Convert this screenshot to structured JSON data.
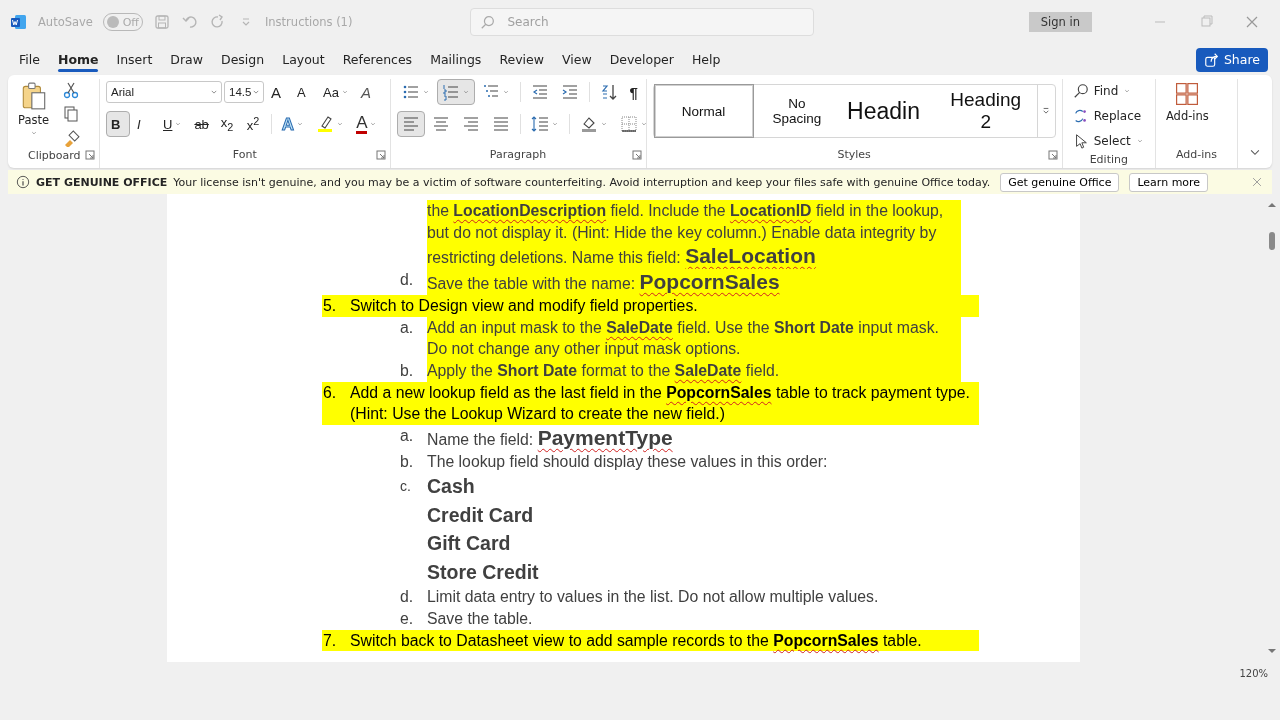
{
  "title_bar": {
    "autosave_label": "AutoSave",
    "autosave_on": false,
    "autosave_state": "Off",
    "document_title": "Instructions (1)",
    "search_placeholder": "Search",
    "sign_in": "Sign in"
  },
  "menu_tabs": [
    {
      "label": "File",
      "selected": false
    },
    {
      "label": "Home",
      "selected": true
    },
    {
      "label": "Insert",
      "selected": false
    },
    {
      "label": "Draw",
      "selected": false
    },
    {
      "label": "Design",
      "selected": false
    },
    {
      "label": "Layout",
      "selected": false
    },
    {
      "label": "References",
      "selected": false
    },
    {
      "label": "Mailings",
      "selected": false
    },
    {
      "label": "Review",
      "selected": false
    },
    {
      "label": "View",
      "selected": false
    },
    {
      "label": "Developer",
      "selected": false
    },
    {
      "label": "Help",
      "selected": false
    }
  ],
  "share": "Share",
  "clipboard": {
    "label": "Clipboard",
    "paste": "Paste"
  },
  "font": {
    "label": "Font",
    "font_name": "Arial",
    "font_size": "14.5",
    "row1": [
      {
        "kind": "grow",
        "text": "A"
      },
      {
        "kind": "shrink",
        "text": "A"
      },
      {
        "kind": "case",
        "text": "Aa"
      },
      {
        "kind": "clear",
        "text": "A"
      }
    ],
    "toggles": [
      {
        "text": "B",
        "selected": true
      },
      {
        "text": "I",
        "selected": false
      },
      {
        "text": "U",
        "selected": false
      },
      {
        "text": "ab",
        "selected": false
      },
      {
        "text": "x$_{2}$",
        "selected": false
      },
      {
        "text": "x$^{2}$",
        "selected": false
      }
    ],
    "row2": [
      {
        "kind": "effects",
        "text": "A"
      },
      {
        "kind": "highlight"
      },
      {
        "kind": "color",
        "text": "A"
      }
    ]
  },
  "paragraph": {
    "label": "Paragraph",
    "row1": [
      {
        "kind": "bullets",
        "selected": false
      },
      {
        "kind": "numbering",
        "selected": true
      },
      {
        "kind": "multilevel",
        "selected": false
      },
      {
        "kind": "outdent",
        "selected": false
      },
      {
        "kind": "indent",
        "selected": false
      },
      {
        "kind": "sort",
        "selected": false
      },
      {
        "kind": "pilcrow",
        "text": "¶",
        "selected": false
      }
    ],
    "row2": [
      {
        "kind": "left",
        "selected": true
      },
      {
        "kind": "center",
        "selected": false
      },
      {
        "kind": "right",
        "selected": false
      },
      {
        "kind": "justify",
        "selected": false
      },
      {
        "kind": "spacing",
        "selected": false
      },
      {
        "kind": "shading",
        "selected": false
      },
      {
        "kind": "borders",
        "selected": false
      }
    ]
  },
  "styles": {
    "label": "Styles",
    "items": [
      {
        "label": "Normal",
        "kind": "normal",
        "selected": true
      },
      {
        "label": "No Spacing",
        "kind": "nospacing",
        "selected": false
      },
      {
        "label": "Headin",
        "kind": "heading1",
        "selected": false
      },
      {
        "label": "Heading 2",
        "kind": "heading2",
        "selected": false
      }
    ]
  },
  "editing": {
    "label": "Editing",
    "items": [
      {
        "label": "Find",
        "kind": "find"
      },
      {
        "label": "Replace",
        "kind": "replace"
      },
      {
        "label": "Select",
        "kind": "select"
      }
    ]
  },
  "addins": {
    "label": "Add-ins",
    "button": "Add-ins"
  },
  "notice": {
    "title": "GET GENUINE OFFICE",
    "message": "Your license isn't genuine, and you may be a victim of software counterfeiting. Avoid interruption and keep your files safe with genuine Office today.",
    "buttons": [
      "Get genuine Office",
      "Learn more"
    ]
  },
  "document": [
    {
      "kind": "sub",
      "highlighted": true,
      "parts": [
        {
          "kind": "plain",
          "text": "the "
        },
        {
          "kind": "field",
          "text": "LocationDescription"
        },
        {
          "kind": "plain",
          "text": " field. Include the "
        },
        {
          "kind": "field",
          "text": "LocationID"
        },
        {
          "kind": "plain",
          "text": " field in the lookup, but do not display it. (Hint: Hide the key column.) Enable data integrity by restricting deletions. Name this field: "
        },
        {
          "kind": "name",
          "text": "SaleLocation"
        }
      ]
    },
    {
      "kind": "sub",
      "label": "d.",
      "highlighted": true,
      "parts": [
        {
          "kind": "plain",
          "text": "Save the table with the name: "
        },
        {
          "kind": "name",
          "text": "PopcornSales"
        }
      ]
    },
    {
      "kind": "top",
      "label": "5.",
      "highlighted": true,
      "parts": [
        {
          "kind": "plain",
          "text": "Switch to Design view and modify field properties."
        }
      ]
    },
    {
      "kind": "sub",
      "label": "a.",
      "highlighted": true,
      "parts": [
        {
          "kind": "plain",
          "text": "Add an input mask to the "
        },
        {
          "kind": "field",
          "text": "SaleDate"
        },
        {
          "kind": "plain",
          "text": " field. Use the "
        },
        {
          "kind": "bold",
          "text": "Short Date"
        },
        {
          "kind": "plain",
          "text": " input mask. Do not change any other input mask options."
        }
      ]
    },
    {
      "kind": "sub",
      "label": "b.",
      "highlighted": true,
      "parts": [
        {
          "kind": "plain",
          "text": "Apply the "
        },
        {
          "kind": "bold",
          "text": "Short Date"
        },
        {
          "kind": "plain",
          "text": " format to the "
        },
        {
          "kind": "field",
          "text": "SaleDate"
        },
        {
          "kind": "plain",
          "text": " field."
        }
      ]
    },
    {
      "kind": "top",
      "label": "6.",
      "highlighted": true,
      "parts": [
        {
          "kind": "plain",
          "text": "Add a new lookup field as the last field in the "
        },
        {
          "kind": "field",
          "text": "PopcornSales"
        },
        {
          "kind": "plain",
          "text": " table to track payment type. (Hint: Use the Lookup Wizard to create the new field.)"
        }
      ]
    },
    {
      "kind": "sub",
      "label": "a.",
      "highlighted": false,
      "parts": [
        {
          "kind": "plain",
          "text": "Name the field: "
        },
        {
          "kind": "name",
          "text": "PaymentType"
        }
      ]
    },
    {
      "kind": "sub",
      "label": "b.",
      "highlighted": false,
      "parts": [
        {
          "kind": "plain",
          "text": "The lookup field should display these values in this order:"
        }
      ]
    },
    {
      "kind": "value",
      "label": "c.",
      "highlighted": false,
      "parts": [
        {
          "kind": "bold",
          "text": "Cash"
        }
      ]
    },
    {
      "kind": "value",
      "highlighted": false,
      "parts": [
        {
          "kind": "bold",
          "text": "Credit Card"
        }
      ]
    },
    {
      "kind": "value",
      "highlighted": false,
      "parts": [
        {
          "kind": "bold",
          "text": "Gift Card"
        }
      ]
    },
    {
      "kind": "value",
      "highlighted": false,
      "parts": [
        {
          "kind": "bold",
          "text": "Store Credit"
        }
      ]
    },
    {
      "kind": "sub",
      "label": "d.",
      "highlighted": false,
      "parts": [
        {
          "kind": "plain",
          "text": "Limit data entry to values in the list. Do not allow multiple values."
        }
      ]
    },
    {
      "kind": "sub",
      "label": "e.",
      "highlighted": false,
      "parts": [
        {
          "kind": "plain",
          "text": "Save the table."
        }
      ]
    },
    {
      "kind": "top",
      "label": "7.",
      "highlighted": true,
      "parts": [
        {
          "kind": "plain",
          "text": "Switch back to Datasheet view to add sample records to the "
        },
        {
          "kind": "field",
          "text": "PopcornSales"
        },
        {
          "kind": "plain",
          "text": " table."
        }
      ]
    }
  ],
  "status_bar": {
    "zoom": "120%"
  }
}
